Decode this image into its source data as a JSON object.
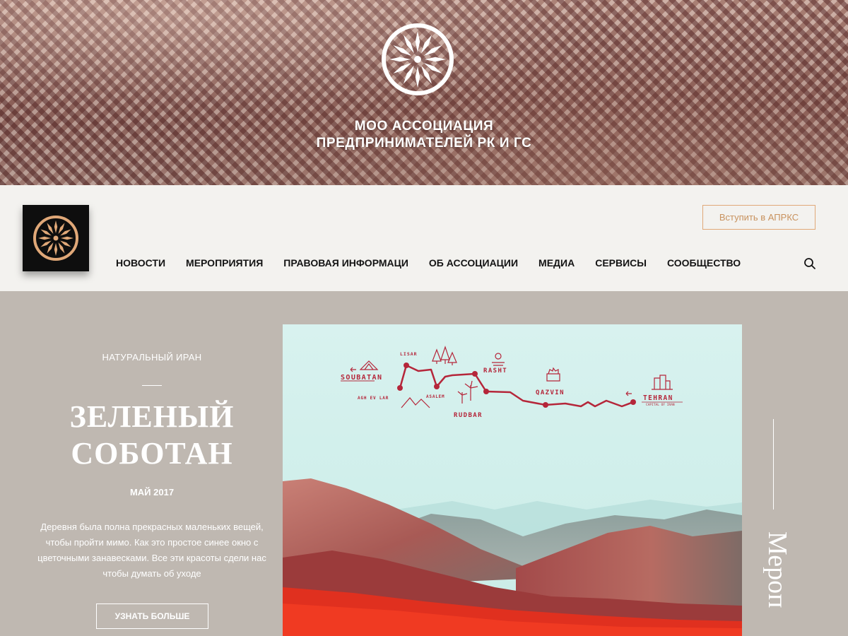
{
  "hero": {
    "title_line1": "МОО АССОЦИАЦИЯ",
    "title_line2": "ПРЕДПРИНИМАТЕЛЕЙ РК И ГС",
    "emblem_icon": "sun-wheel-emblem-icon"
  },
  "nav": {
    "logo_icon": "sun-wheel-logo-icon",
    "join_label": "Вступить в АПРКС",
    "items": [
      {
        "label": "НОВОСТИ"
      },
      {
        "label": "МЕРОПРИЯТИЯ"
      },
      {
        "label": "ПРАВОВАЯ ИНФОРМАЦИ"
      },
      {
        "label": "ОБ АССОЦИАЦИИ"
      },
      {
        "label": "МЕДИА"
      },
      {
        "label": "СЕРВИСЫ"
      },
      {
        "label": "СООБЩЕСТВО"
      }
    ],
    "search_icon": "search-icon"
  },
  "feature": {
    "category": "НАТУРАЛЬНЫЙ ИРАН",
    "title_line1": "ЗЕЛЕНЫЙ",
    "title_line2": "СОБОТАН",
    "date": "МАЙ 2017",
    "description": "Деревня была полна прекрасных маленьких вещей, чтобы пройти мимо. Как это простое синее окно с цветочными занавесками. Все эти красоты сдели нас чтобы думать об уходе",
    "more_label": "УЗНАТЬ БОЛЬШЕ",
    "side_label": "Мероп"
  },
  "map": {
    "route_color": "#b5263a",
    "places": {
      "soubatan": "SOUBATAN",
      "lisar": "LISAR",
      "agh_ev_lar": "AGH EV LAR",
      "asalem": "ASALEM",
      "rasht": "RASHT",
      "rudbar": "RUDBAR",
      "qazvin": "QAZVIN",
      "tehran": "TEHRAN",
      "tehran_sub": "CAPITAL OF IRAN"
    }
  },
  "colors": {
    "accent": "#e0a878",
    "dark": "#0e0e0e",
    "panel": "#bfb8b1",
    "nav_bg": "#f3f2ef"
  }
}
